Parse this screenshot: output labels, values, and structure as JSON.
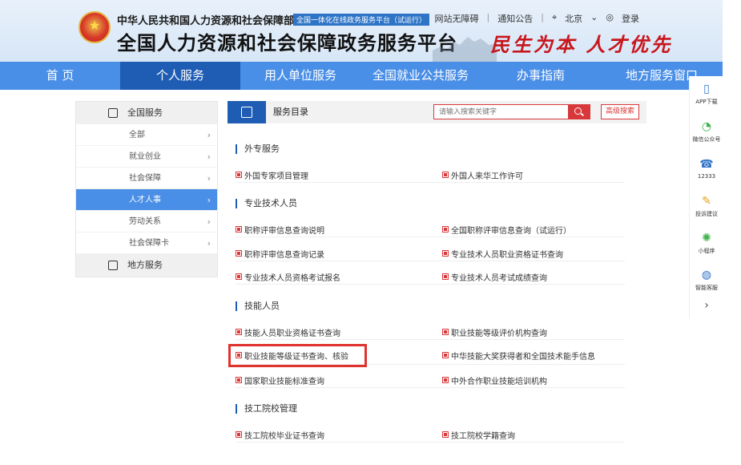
{
  "header": {
    "ministry": "中华人民共和国人力资源和社会保障部",
    "beta_tag": "全国一体化在线政务服务平台（试运行）",
    "platform_title": "全国人力资源和社会保障政务服务平台",
    "slogan": "民生为本 人才优先",
    "links": {
      "accessibility": "网站无障碍",
      "notice": "通知公告",
      "location": "北京",
      "login": "登录"
    }
  },
  "nav": [
    {
      "label": "首 页"
    },
    {
      "label": "个人服务"
    },
    {
      "label": "用人单位服务"
    },
    {
      "label": "全国就业公共服务"
    },
    {
      "label": "办事指南"
    },
    {
      "label": "地方服务窗口"
    }
  ],
  "sidebar": {
    "national_label": "全国服务",
    "items": [
      {
        "label": "全部"
      },
      {
        "label": "就业创业"
      },
      {
        "label": "社会保障"
      },
      {
        "label": "人才人事"
      },
      {
        "label": "劳动关系"
      },
      {
        "label": "社会保障卡"
      }
    ],
    "local_label": "地方服务"
  },
  "main": {
    "title": "服务目录",
    "search_placeholder": "请输入搜索关键字",
    "advanced_search": "高级搜索",
    "sections": [
      {
        "title": "外专服务",
        "items": [
          "外国专家项目管理",
          "外国人来华工作许可"
        ]
      },
      {
        "title": "专业技术人员",
        "items": [
          "职称评审信息查询说明",
          "全国职称评审信息查询（试运行）",
          "职称评审信息查询记录",
          "专业技术人员职业资格证书查询",
          "专业技术人员资格考试报名",
          "专业技术人员考试成绩查询"
        ]
      },
      {
        "title": "技能人员",
        "items": [
          "技能人员职业资格证书查询",
          "职业技能等级评价机构查询",
          "职业技能等级证书查询、核验",
          "中华技能大奖获得者和全国技术能手信息",
          "国家职业技能标准查询",
          "中外合作职业技能培训机构"
        ]
      },
      {
        "title": "技工院校管理",
        "items": [
          "技工院校毕业证书查询",
          "技工院校学籍查询"
        ]
      }
    ]
  },
  "rightbar": {
    "app": "APP下载",
    "wechat": "微信公众号",
    "hotline": "12333",
    "complaint": "投诉建议",
    "miniapp": "小程序",
    "support": "智能客服"
  },
  "colors": {
    "nav": "#4a8fe7",
    "nav_active": "#1f5db4",
    "accent_red": "#d9383a",
    "highlight": "#e0332e"
  }
}
